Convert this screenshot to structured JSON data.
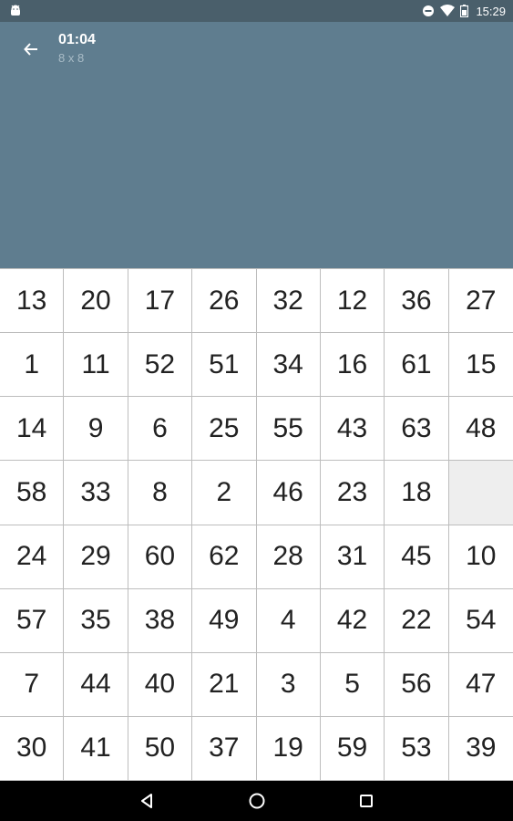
{
  "status_bar": {
    "time": "15:29",
    "icons": [
      "android-icon",
      "do-not-disturb-icon",
      "wifi-icon",
      "battery-icon"
    ]
  },
  "header": {
    "timer": "01:04",
    "board_size": "8 x 8",
    "back_icon": "arrow-left-icon"
  },
  "board": {
    "rows": 8,
    "cols": 8,
    "tiles": [
      "13",
      "20",
      "17",
      "26",
      "32",
      "12",
      "36",
      "27",
      "1",
      "11",
      "52",
      "51",
      "34",
      "16",
      "61",
      "15",
      "14",
      "9",
      "6",
      "25",
      "55",
      "43",
      "63",
      "48",
      "58",
      "33",
      "8",
      "2",
      "46",
      "23",
      "18",
      "",
      "24",
      "29",
      "60",
      "62",
      "28",
      "31",
      "45",
      "10",
      "57",
      "35",
      "38",
      "49",
      "4",
      "42",
      "22",
      "54",
      "7",
      "44",
      "40",
      "21",
      "3",
      "5",
      "56",
      "47",
      "30",
      "41",
      "50",
      "37",
      "19",
      "59",
      "53",
      "39"
    ]
  },
  "nav_bar": {
    "buttons": [
      "back-triangle-icon",
      "home-circle-icon",
      "recents-square-icon"
    ]
  },
  "colors": {
    "status_bar": "#4a5f6b",
    "app_bar": "#5f7d8f",
    "empty_tile": "#eeeeee",
    "grid_line": "#bdbdbd"
  }
}
